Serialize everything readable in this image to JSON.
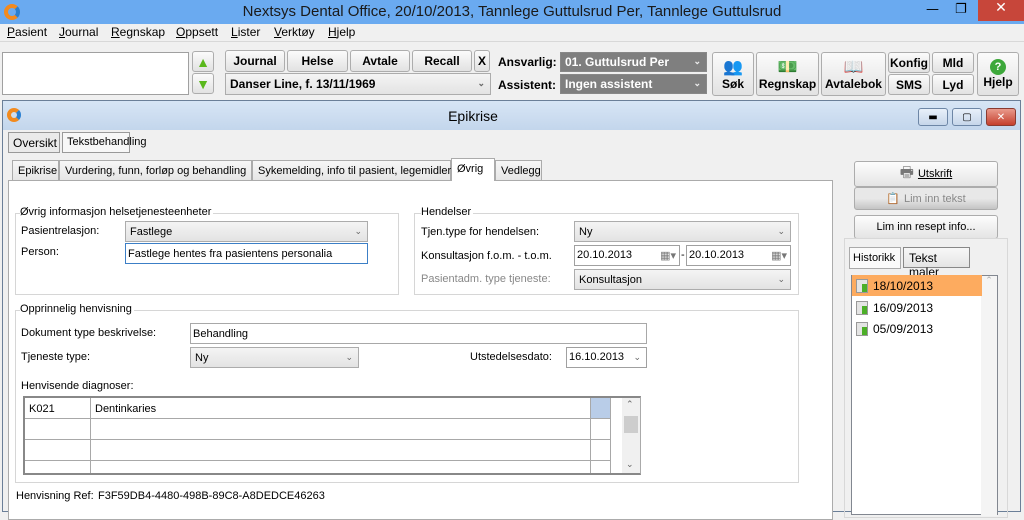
{
  "app": {
    "title": "Nextsys Dental Office,  20/10/2013, Tannlege Guttulsrud Per,  Tannlege Guttulsrud"
  },
  "menu": [
    "Pasient",
    "Journal",
    "Regnskap",
    "Oppsett",
    "Lister",
    "Verktøy",
    "Hjelp"
  ],
  "toolbar": {
    "search_value": "",
    "nav_buttons": [
      "Journal",
      "Helse",
      "Avtale",
      "Recall",
      "X"
    ],
    "patient": "Danser Line, f. 13/11/1969",
    "ansvarlig_label": "Ansvarlig:",
    "ansvarlig_value": "01. Guttulsrud Per",
    "assistent_label": "Assistent:",
    "assistent_value": "Ingen assistent",
    "sok": "Søk",
    "regnskap": "Regnskap",
    "avtalebok": "Avtalebok",
    "konfig": "Konfig",
    "sms": "SMS",
    "mld": "Mld",
    "lyd": "Lyd",
    "hjelp": "Hjelp"
  },
  "window": {
    "title": "Epikrise",
    "top_buttons": [
      "Oversikt",
      "Tekstbehandling"
    ],
    "tabs": [
      "Epikrise",
      "Vurdering, funn, forløp og behandling",
      "Sykemelding, info til pasient, legemidler",
      "Øvrig",
      "Vedlegg"
    ],
    "active_tab": "Øvrig"
  },
  "ovrig": {
    "group_title": "Øvrig informasjon helsetjenesteenheter",
    "pasientrelasjon_label": "Pasientrelasjon:",
    "pasientrelasjon_value": "Fastlege",
    "person_label": "Person:",
    "person_value": "Fastlege hentes fra pasientens personalia"
  },
  "hendelser": {
    "group_title": "Hendelser",
    "tjen_label": "Tjen.type for hendelsen:",
    "tjen_value": "Ny",
    "kons_label": "Konsultasjon f.o.m. - t.o.m.",
    "from": "20.10.2013",
    "dash": "-",
    "to": "20.10.2013",
    "pasadm_label": "Pasientadm. type tjeneste:",
    "pasadm_value": "Konsultasjon"
  },
  "henvisning": {
    "group_title": "Opprinnelig henvisning",
    "dok_label": "Dokument type beskrivelse:",
    "dok_value": "Behandling",
    "tjeneste_label": "Tjeneste type:",
    "tjeneste_value": "Ny",
    "utst_label": "Utstedelsesdato:",
    "utst_value": "16.10.2013",
    "diag_label": "Henvisende diagnoser:",
    "diagnoses": [
      {
        "code": "K021",
        "name": "Dentinkaries"
      }
    ],
    "ref_label": "Henvisning Ref:",
    "ref_value": "F3F59DB4-4480-498B-89C8-A8DEDCE46263"
  },
  "side": {
    "utskrift": "Utskrift",
    "lim_tekst": "Lim inn tekst",
    "lim_resept": "Lim inn resept info...",
    "tabs": [
      "Historikk",
      "Tekst maler"
    ],
    "history": [
      "18/10/2013",
      "16/09/2013",
      "05/09/2013"
    ],
    "selected": "18/10/2013",
    "selected_color": "#fdab5f"
  }
}
